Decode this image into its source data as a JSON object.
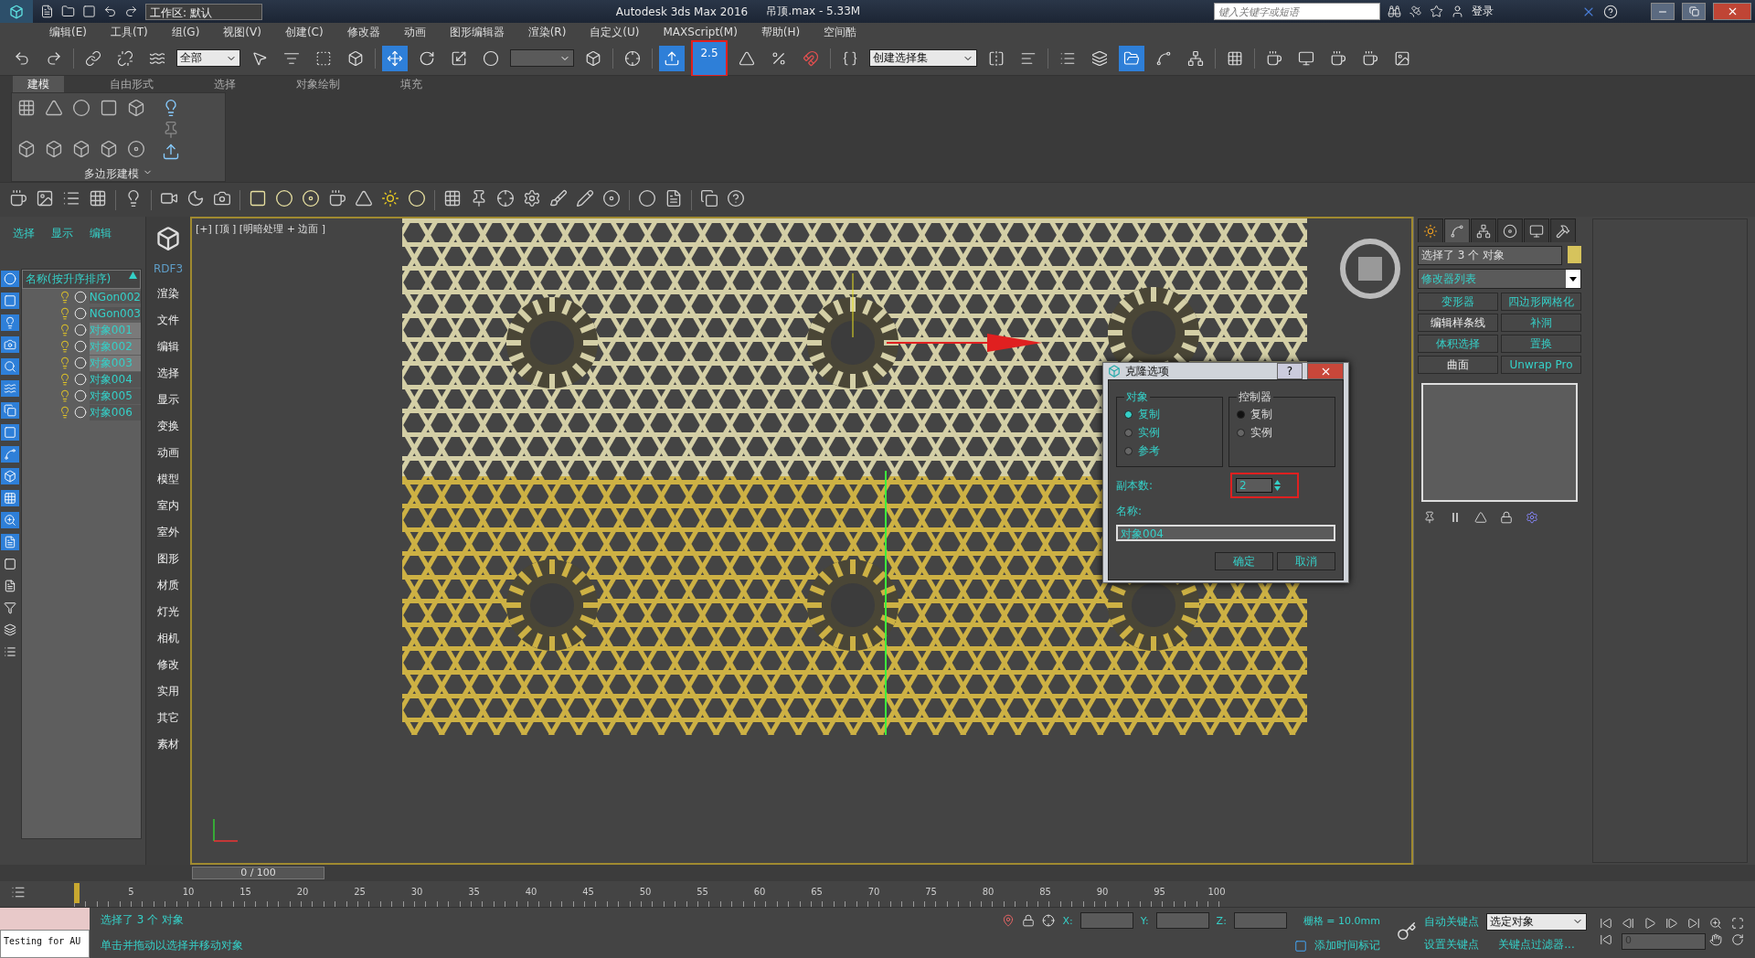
{
  "title_bar": {
    "workspace": "工作区: 默认",
    "title": "Autodesk 3ds Max 2016",
    "file": "吊顶.max - 5.33M",
    "search": {
      "placeholder": "键入关键字或短语"
    },
    "sign_in": "登录"
  },
  "menu": [
    "编辑(E)",
    "工具(T)",
    "组(G)",
    "视图(V)",
    "创建(C)",
    "修改器",
    "动画",
    "图形编辑器",
    "渲染(R)",
    "自定义(U)",
    "MAXScript(M)",
    "帮助(H)",
    "空间酷"
  ],
  "main_toolbar": {
    "selection_filter": "全部",
    "move_active": true,
    "snap_toggle_active": true,
    "snap_value": "2.5",
    "snap_highlighted": true,
    "named_selection": "创建选择集",
    "scene_explorer_active": true
  },
  "ribbon": {
    "tabs": [
      {
        "label": "建模",
        "selected": true
      },
      {
        "label": "自由形式",
        "selected": false
      },
      {
        "label": "选择",
        "selected": false
      },
      {
        "label": "对象绘制",
        "selected": false
      },
      {
        "label": "填充",
        "selected": false
      }
    ],
    "panel_label": "多边形建模"
  },
  "scene_explorer": {
    "tabs": [
      "选择",
      "显示",
      "编辑"
    ],
    "column": "名称(按升序排序)",
    "items": [
      {
        "name": "NGon002",
        "selected": false
      },
      {
        "name": "NGon003",
        "selected": false
      },
      {
        "name": "对象001",
        "selected": true
      },
      {
        "name": "对象002",
        "selected": true
      },
      {
        "name": "对象003",
        "selected": true
      },
      {
        "name": "对象004",
        "selected": false
      },
      {
        "name": "对象005",
        "selected": false
      },
      {
        "name": "对象006",
        "selected": false
      }
    ]
  },
  "command_column": [
    "RDF3",
    "渲染",
    "文件",
    "编辑",
    "选择",
    "显示",
    "变换",
    "动画",
    "模型",
    "室内",
    "室外",
    "图形",
    "材质",
    "灯光",
    "相机",
    "修改",
    "实用",
    "其它",
    "素材"
  ],
  "viewport": {
    "label": "[+] [顶 ] [明暗处理 + 边面 ]"
  },
  "clone_dialog": {
    "title": "克隆选项",
    "object_group": "对象",
    "object_options": [
      {
        "label": "复制",
        "selected": true
      },
      {
        "label": "实例",
        "selected": false
      },
      {
        "label": "参考",
        "selected": false
      }
    ],
    "controller_group": "控制器",
    "controller_options": [
      {
        "label": "复制",
        "selected": true
      },
      {
        "label": "实例",
        "selected": false
      }
    ],
    "copies_label": "副本数:",
    "copies": "2",
    "copies_highlighted": true,
    "name_label": "名称:",
    "name": "对象004",
    "ok": "确定",
    "cancel": "取消",
    "help": "?"
  },
  "command_panel": {
    "tabs": [
      {
        "selected": false
      },
      {
        "selected": true
      },
      {
        "selected": false
      },
      {
        "selected": false
      },
      {
        "selected": false
      },
      {
        "selected": false
      }
    ],
    "selection": "选择了 3 个 对象",
    "color": "#d6c35c",
    "modifier_list": "修改器列表",
    "modifier_buttons": [
      {
        "label": "变形器",
        "kind": "set"
      },
      {
        "label": "四边形网格化",
        "kind": "set"
      },
      {
        "label": "编辑样条线",
        "kind": "plain"
      },
      {
        "label": "补洞",
        "kind": "set"
      },
      {
        "label": "体积选择",
        "kind": "set"
      },
      {
        "label": "置换",
        "kind": "set"
      },
      {
        "label": "曲面",
        "kind": "plain"
      },
      {
        "label": "Unwrap Pro",
        "kind": "set"
      }
    ]
  },
  "timeline": {
    "frame": "0 / 100",
    "ticks": [
      "5",
      "10",
      "15",
      "20",
      "25",
      "30",
      "35",
      "40",
      "45",
      "50",
      "55",
      "60",
      "65",
      "70",
      "75",
      "80",
      "85",
      "90",
      "95",
      "100"
    ]
  },
  "status_bar": {
    "listener": "Testing for AU",
    "selection": "选择了 3 个 对象",
    "prompt": "单击并拖动以选择并移动对象",
    "x_label": "X:",
    "y_label": "Y:",
    "z_label": "Z:",
    "grid": "栅格 = 10.0mm",
    "add_time_tag": "添加时间标记",
    "auto_key": "自动关键点",
    "set_key": "设置关键点",
    "key_mode": "选定对象",
    "key_filters": "关键点过滤器...",
    "frame": "0"
  }
}
